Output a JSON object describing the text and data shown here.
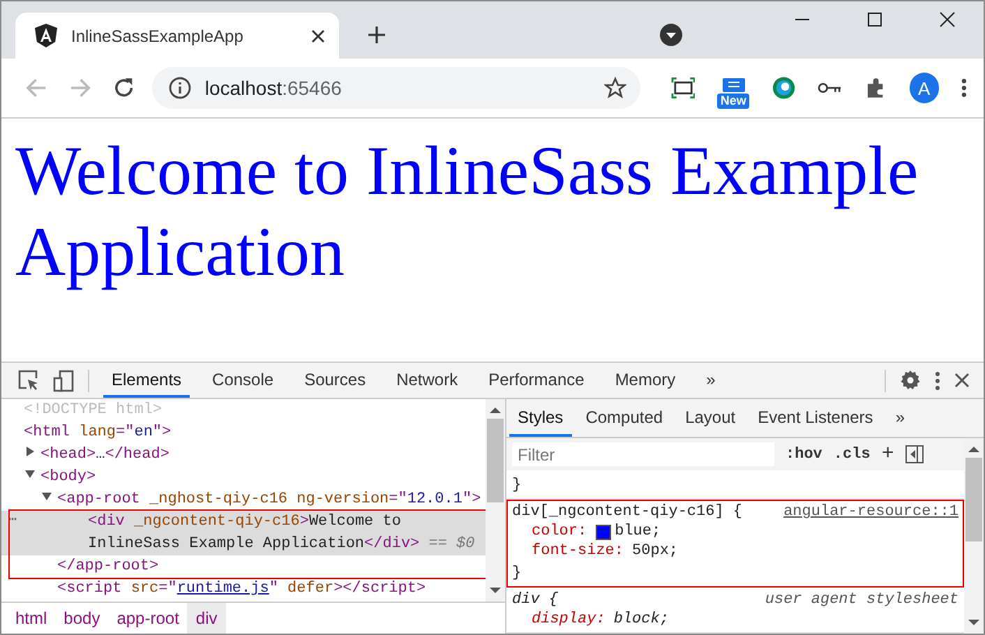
{
  "browser": {
    "tab": {
      "title": "InlineSassExampleApp",
      "selected": true
    },
    "address": {
      "host": "localhost",
      "port": ":65466"
    },
    "extension_badge": "New",
    "avatar": "A"
  },
  "page": {
    "heading": "Welcome to InlineSass Example Application"
  },
  "devtools": {
    "tabs": [
      {
        "label": "Elements",
        "selected": true
      },
      {
        "label": "Console",
        "selected": false
      },
      {
        "label": "Sources",
        "selected": false
      },
      {
        "label": "Network",
        "selected": false
      },
      {
        "label": "Performance",
        "selected": false
      },
      {
        "label": "Memory",
        "selected": false
      }
    ],
    "tabs_overflow": "»",
    "selected_marker": "⋯",
    "dom": [
      {
        "tokens": [
          {
            "kind": "faded",
            "text": "<!DOCTYPE html>"
          }
        ],
        "selected": false
      },
      {
        "tokens": [
          {
            "kind": "tag",
            "text": "<html "
          },
          {
            "kind": "attr",
            "text": "lang"
          },
          {
            "kind": "tag",
            "text": "=\""
          },
          {
            "kind": "val",
            "text": "en"
          },
          {
            "kind": "tag",
            "text": "\">"
          }
        ],
        "selected": false,
        "children": [
          {
            "tokens": [
              {
                "kind": "tag",
                "text": "<head>"
              },
              {
                "kind": "text",
                "text": "…"
              },
              {
                "kind": "tag",
                "text": "</head>"
              }
            ],
            "selected": false,
            "expanded": false
          },
          {
            "tokens": [
              {
                "kind": "tag",
                "text": "<body>"
              }
            ],
            "selected": false,
            "expanded": true,
            "children": [
              {
                "tokens": [
                  {
                    "kind": "tag",
                    "text": "<app-root "
                  },
                  {
                    "kind": "attr",
                    "text": "_nghost-qiy-c16 ng-version"
                  },
                  {
                    "kind": "tag",
                    "text": "=\""
                  },
                  {
                    "kind": "val",
                    "text": "12.0.1"
                  },
                  {
                    "kind": "tag",
                    "text": "\">"
                  }
                ],
                "selected": false,
                "expanded": true,
                "closing": "</app-root>",
                "children": [
                  {
                    "tokens": [
                      {
                        "kind": "tag",
                        "text": "<div "
                      },
                      {
                        "kind": "attr",
                        "text": "_ngcontent-qiy-c16"
                      },
                      {
                        "kind": "tag",
                        "text": ">"
                      },
                      {
                        "kind": "text",
                        "text": "Welcome to InlineSass Example Application"
                      },
                      {
                        "kind": "tag",
                        "text": "</div>"
                      },
                      {
                        "kind": "dim",
                        "text": " == $0"
                      }
                    ],
                    "selected": true
                  }
                ]
              },
              {
                "tokens": [
                  {
                    "kind": "tag",
                    "text": "<script "
                  },
                  {
                    "kind": "attr",
                    "text": "src"
                  },
                  {
                    "kind": "tag",
                    "text": "=\""
                  },
                  {
                    "kind": "link",
                    "text": "runtime.js"
                  },
                  {
                    "kind": "tag",
                    "text": "\" "
                  },
                  {
                    "kind": "attr",
                    "text": "defer"
                  },
                  {
                    "kind": "tag",
                    "text": "></script>"
                  }
                ],
                "selected": false
              }
            ]
          }
        ]
      }
    ],
    "breadcrumbs": [
      {
        "label": "html",
        "selected": false
      },
      {
        "label": "body",
        "selected": false
      },
      {
        "label": "app-root",
        "selected": false
      },
      {
        "label": "div",
        "selected": true
      }
    ],
    "side_tabs": [
      {
        "label": "Styles",
        "selected": true
      },
      {
        "label": "Computed",
        "selected": false
      },
      {
        "label": "Layout",
        "selected": false
      },
      {
        "label": "Event Listeners",
        "selected": false
      }
    ],
    "side_tabs_overflow": "»",
    "filter": {
      "placeholder": "Filter"
    },
    "hov": ":hov",
    "cls": ".cls",
    "plus": "+",
    "prev_rule_end": "}",
    "rules": [
      {
        "selector": "div[_ngcontent-qiy-c16] {",
        "source": "angular-resource::1",
        "kind": "author",
        "highlighted": true,
        "props": [
          {
            "name": "color:",
            "value": "blue;",
            "color": "#0000ff"
          },
          {
            "name": "font-size:",
            "value": "50px;"
          }
        ],
        "close": "}"
      },
      {
        "selector": "div {",
        "source": "user agent stylesheet",
        "kind": "useragent",
        "highlighted": false,
        "props": [
          {
            "name": "display:",
            "value": "block;"
          }
        ]
      }
    ]
  }
}
